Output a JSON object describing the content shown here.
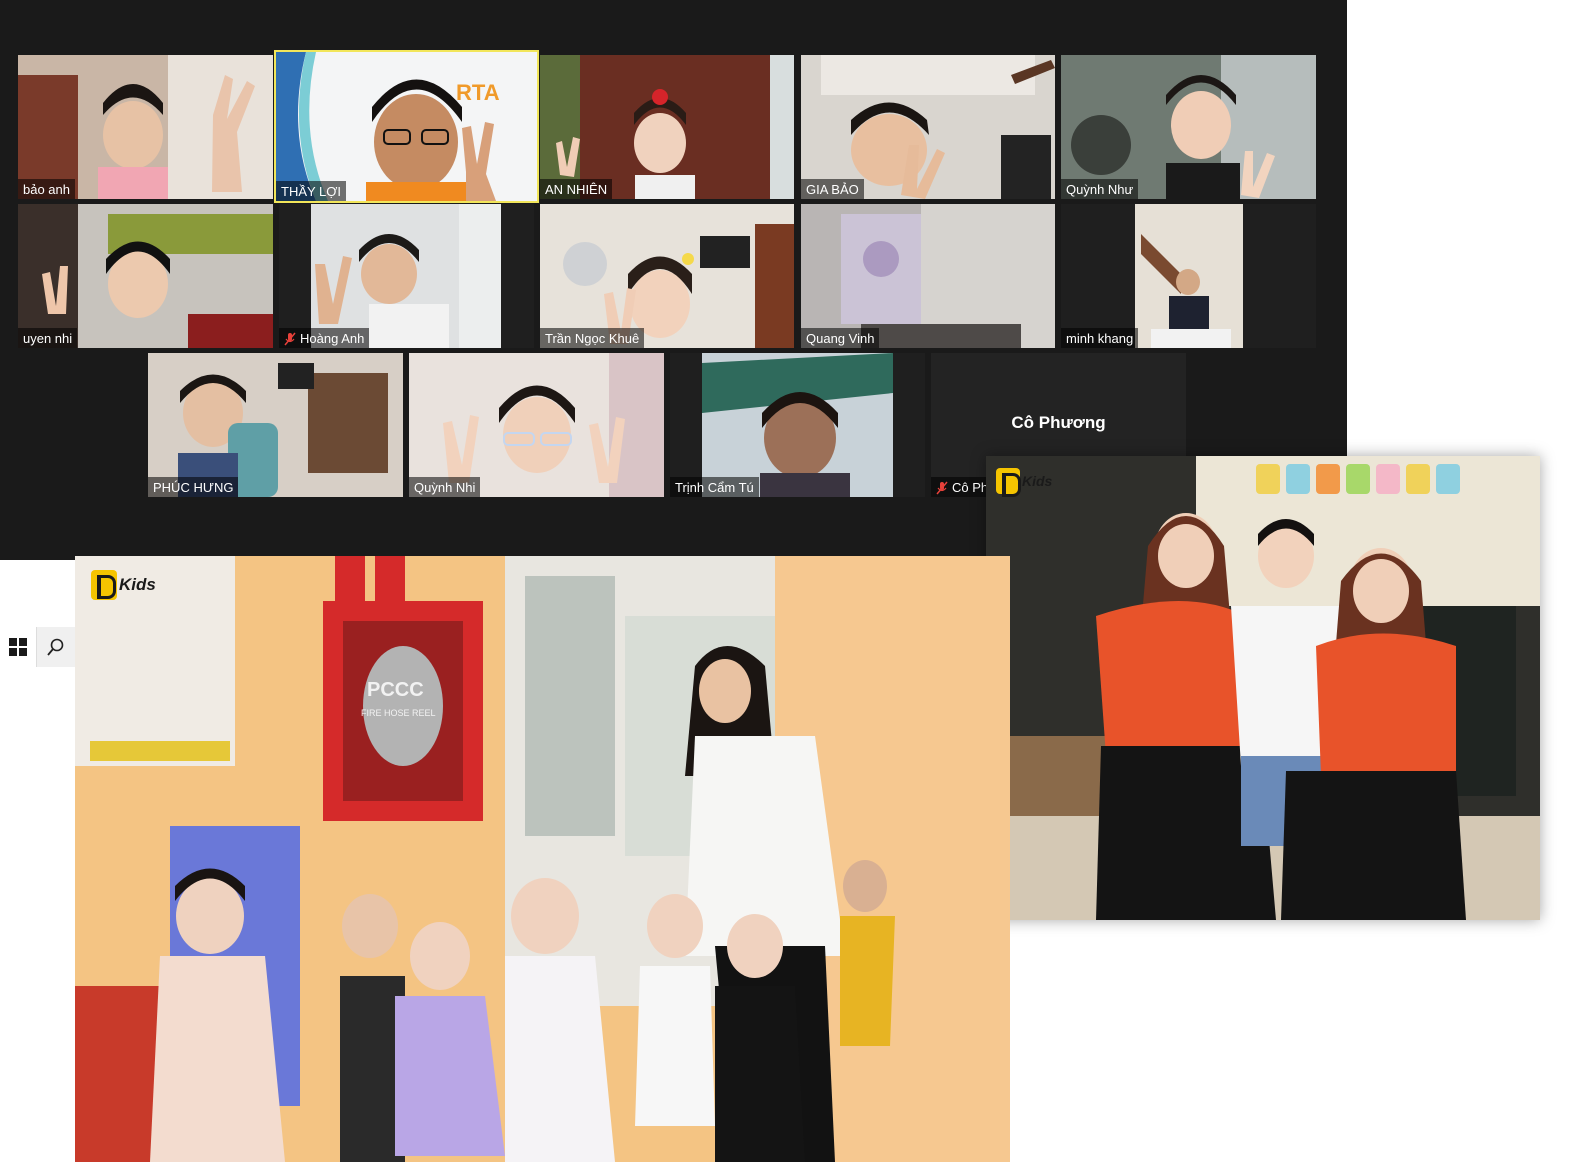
{
  "zoom_gallery": {
    "participants": [
      {
        "name": "bảo anh",
        "muted": false
      },
      {
        "name": "THẦY LỢI",
        "muted": false,
        "active_speaker": true
      },
      {
        "name": "AN NHIÊN",
        "muted": false
      },
      {
        "name": "GIA BẢO",
        "muted": false
      },
      {
        "name": "Quỳnh Như",
        "muted": false
      },
      {
        "name": "uyen nhi",
        "muted": false
      },
      {
        "name": "Hoàng Anh",
        "muted": true
      },
      {
        "name": "Trần Ngọc Khuê",
        "muted": false
      },
      {
        "name": "Quang Vinh",
        "muted": false
      },
      {
        "name": "minh khang",
        "muted": false
      },
      {
        "name": "PHÚC HƯNG",
        "muted": false
      },
      {
        "name": "Quỳnh Nhi",
        "muted": false
      },
      {
        "name": "Trịnh Cẩm Tú",
        "muted": false
      },
      {
        "name": "Cô Phương",
        "muted": true,
        "video_off": true,
        "label_short": "Cô Ph"
      }
    ],
    "active_color": "#f2e65a"
  },
  "taskbar": {
    "icons": [
      "windows-start-icon",
      "search-icon"
    ]
  },
  "photos": {
    "classroom": {
      "logo_text": "Kids",
      "sign_text": "PCCC",
      "sign_sub": "FIRE HOSE REEL"
    },
    "teachers": {
      "logo_text": "Kids"
    }
  },
  "colors": {
    "background": "#1a1a1a",
    "uniform_orange": "#e8532a",
    "logo_yellow": "#f5c400"
  }
}
